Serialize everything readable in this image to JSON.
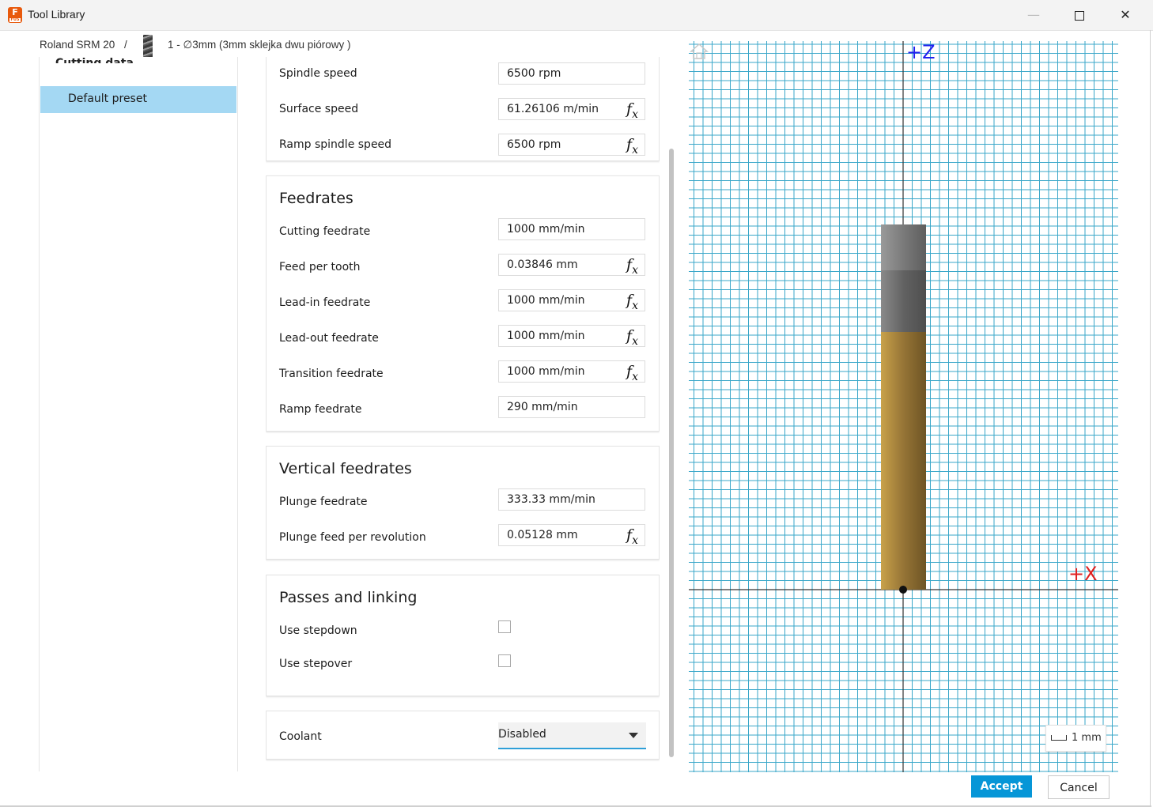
{
  "window": {
    "title": "Tool Library",
    "logo_letter": "F",
    "logo_sub": "FUS",
    "minimize": "—",
    "close": "✕"
  },
  "breadcrumb": {
    "machine": "Roland SRM 20",
    "separator": "/",
    "tool": "1 - ∅3mm (3mm sklejka dwu piórowy )"
  },
  "left_panel": {
    "heading": "Cutting data",
    "items": [
      {
        "label": "Default preset",
        "selected": true
      }
    ]
  },
  "speed": {
    "rows": [
      {
        "label": "Spindle speed",
        "value": "6500 rpm",
        "fx": false
      },
      {
        "label": "Surface speed",
        "value": "61.26106 m/min",
        "fx": true
      },
      {
        "label": "Ramp spindle speed",
        "value": "6500 rpm",
        "fx": true
      }
    ]
  },
  "feedrates": {
    "title": "Feedrates",
    "rows": [
      {
        "label": "Cutting feedrate",
        "value": "1000 mm/min",
        "fx": false
      },
      {
        "label": "Feed per tooth",
        "value": "0.03846 mm",
        "fx": true
      },
      {
        "label": "Lead-in feedrate",
        "value": "1000 mm/min",
        "fx": true
      },
      {
        "label": "Lead-out feedrate",
        "value": "1000 mm/min",
        "fx": true
      },
      {
        "label": "Transition feedrate",
        "value": "1000 mm/min",
        "fx": true
      },
      {
        "label": "Ramp feedrate",
        "value": "290 mm/min",
        "fx": false
      }
    ]
  },
  "vertical_feedrates": {
    "title": "Vertical feedrates",
    "rows": [
      {
        "label": "Plunge feedrate",
        "value": "333.33 mm/min",
        "fx": false
      },
      {
        "label": "Plunge feed per revolution",
        "value": "0.05128 mm",
        "fx": true
      }
    ]
  },
  "passes": {
    "title": "Passes and linking",
    "rows": [
      {
        "label": "Use stepdown",
        "checked": false
      },
      {
        "label": "Use stepover",
        "checked": false
      }
    ]
  },
  "coolant": {
    "label": "Coolant",
    "value": "Disabled"
  },
  "fx_symbol": "f",
  "fx_sub": "x",
  "viewer": {
    "z_label": "+Z",
    "x_label": "+X",
    "scale_label": "1 mm",
    "colors": {
      "grid": "#3aa7c9",
      "axis": "#333333",
      "shank": "#7f7f7f",
      "flute": "#b8913a"
    }
  },
  "buttons": {
    "accept": "Accept",
    "cancel": "Cancel"
  }
}
